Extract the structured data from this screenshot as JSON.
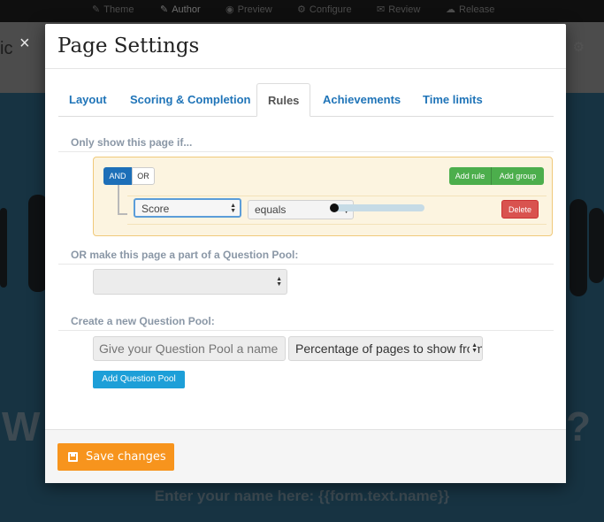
{
  "topnav": [
    {
      "label": "Theme",
      "icon": "brush-icon",
      "glyph": "✎"
    },
    {
      "label": "Author",
      "icon": "pencil-icon",
      "glyph": "✎"
    },
    {
      "label": "Preview",
      "icon": "eye-icon",
      "glyph": "◉"
    },
    {
      "label": "Configure",
      "icon": "gears-icon",
      "glyph": "⚙"
    },
    {
      "label": "Review",
      "icon": "comments-icon",
      "glyph": "✉"
    },
    {
      "label": "Release",
      "icon": "cloud-upload-icon",
      "glyph": "☁"
    }
  ],
  "background": {
    "left_text": "ic",
    "big_left": "W",
    "big_right": "?",
    "name_prompt": "Enter your name here: {{form.text.name}}"
  },
  "modal": {
    "title": "Page Settings",
    "close_glyph": "×",
    "tabs": [
      "Layout",
      "Scoring & Completion",
      "Rules",
      "Achievements",
      "Time limits"
    ],
    "active_tab": "Rules",
    "rules": {
      "section_label": "Only show this page if...",
      "and_label": "AND",
      "or_label": "OR",
      "add_rule_label": "Add rule",
      "add_group_label": "Add group",
      "field_value": "Score",
      "operator_value": "equals",
      "slider_value": 0,
      "delete_label": "Delete"
    },
    "pool": {
      "section_label": "OR make this page a part of a Question Pool:",
      "selected": ""
    },
    "new_pool": {
      "section_label": "Create a new Question Pool:",
      "name_placeholder": "Give your Question Pool a name",
      "mode_value": "Percentage of pages to show from",
      "add_label": "Add Question Pool"
    },
    "footer": {
      "save_label": "Save changes"
    }
  },
  "colors": {
    "accent_blue": "#1f74b8",
    "save_orange": "#f7941d",
    "add_green": "#4cae4c",
    "delete_red": "#d9534f",
    "pool_button_blue": "#1d9fd8"
  }
}
